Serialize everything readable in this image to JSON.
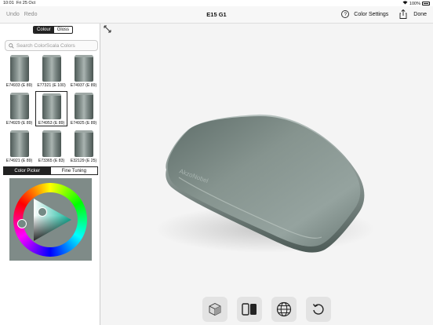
{
  "status": {
    "time": "10:01",
    "date": "Fri 25 Oct",
    "battery": "100%"
  },
  "nav": {
    "undo": "Undo",
    "redo": "Redo",
    "title": "E15 G1",
    "help": "?",
    "color_settings": "Color Settings",
    "done": "Done"
  },
  "sidebar": {
    "segments": [
      "Colour",
      "Gloss"
    ],
    "search_placeholder": "Search ColorScala Colors",
    "swatches": [
      {
        "label": "E74933 (E 89)"
      },
      {
        "label": "E77321 (E 100)"
      },
      {
        "label": "E74937 (E 89)"
      },
      {
        "label": "E74929 (E 89)"
      },
      {
        "label": "E74953 (E 89)",
        "selected": true
      },
      {
        "label": "E74925 (E 89)"
      },
      {
        "label": "E74921 (E 89)"
      },
      {
        "label": "E73365 (E 83)"
      },
      {
        "label": "E32129 (E 25)"
      }
    ],
    "tabs": [
      "Color Picker",
      "Fine Tuning"
    ]
  },
  "model": {
    "brand": "AkzoNobel",
    "color": "#7d8c88"
  },
  "toolbar": {
    "icons": [
      "cube-icon",
      "compare-icon",
      "globe-icon",
      "reset-icon"
    ]
  }
}
